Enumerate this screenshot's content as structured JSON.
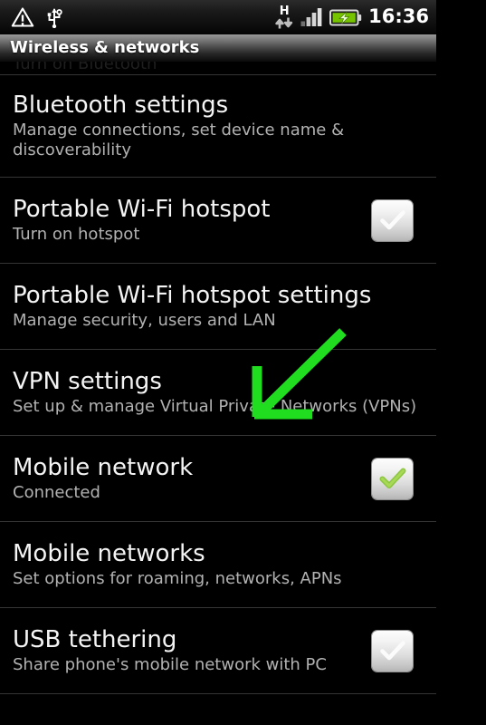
{
  "status_bar": {
    "icons_left": [
      "warning-triangle-icon",
      "usb-icon"
    ],
    "network_type": "H",
    "data_arrows": "up-down-data-icon",
    "signal": "signal-bars-icon",
    "signal_bars_filled": 3,
    "signal_bars_total": 4,
    "battery": "battery-charging-icon",
    "clock": "16:36"
  },
  "title_bar": {
    "title": "Wireless & networks"
  },
  "list": {
    "clipped_top_item": {
      "subtitle": "Turn on Bluetooth"
    },
    "items": [
      {
        "title": "Bluetooth settings",
        "subtitle": "Manage connections, set device name & discoverability",
        "checkbox": "none",
        "two_line_subtitle": true
      },
      {
        "title": "Portable Wi-Fi hotspot",
        "subtitle": "Turn on hotspot",
        "checkbox": "unchecked"
      },
      {
        "title": "Portable Wi-Fi hotspot settings",
        "subtitle": "Manage security, users and LAN",
        "checkbox": "none"
      },
      {
        "title": "VPN settings",
        "subtitle": "Set up & manage Virtual Private Networks (VPNs)",
        "checkbox": "none"
      },
      {
        "title": "Mobile network",
        "subtitle": "Connected",
        "checkbox": "checked"
      },
      {
        "title": "Mobile networks",
        "subtitle": "Set options for roaming, networks, APNs",
        "checkbox": "none"
      },
      {
        "title": "USB tethering",
        "subtitle": "Share phone's mobile network with PC",
        "checkbox": "unchecked"
      }
    ]
  },
  "annotation": {
    "type": "arrow",
    "color": "#20dd20",
    "points_to": "VPN settings row",
    "from": "378,366",
    "to": "285,458"
  },
  "colors": {
    "background": "#000000",
    "title_text": "#ffffff",
    "item_title": "#f4f4f4",
    "item_subtitle": "#b2b2b2",
    "divider": "#353535",
    "checkmark_green": "#8cc63f",
    "annotation_green": "#20dd20",
    "battery_green": "#76c300"
  }
}
